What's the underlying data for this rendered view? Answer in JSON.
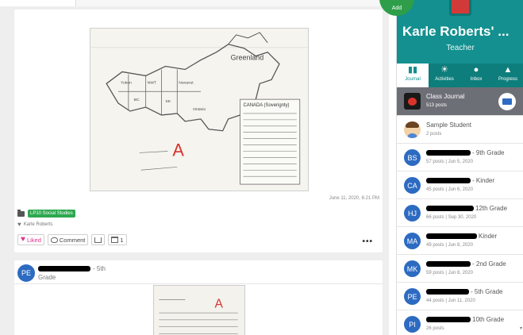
{
  "header": {
    "tab_text": "",
    "add_label": "Add"
  },
  "post1": {
    "date": "June 11, 2020, 6:21 PM",
    "tag": "LP10 Social Studies",
    "liker": "Karle Roberts",
    "like_label": "Liked",
    "comment_label": "Comment",
    "folder_count": "1",
    "more": "•••",
    "photo_note_title": "CANADA (Soverignty)",
    "photo_grade": "A"
  },
  "post2": {
    "initials": "PE",
    "name_suffix": "- 5th",
    "grade_word": "Grade",
    "photo_grade": "A"
  },
  "panel": {
    "name": "Karle Roberts' ...",
    "role": "Teacher",
    "tabs": [
      {
        "label": "Journal",
        "icon": "book-icon"
      },
      {
        "label": "Activities",
        "icon": "lightbulb-icon"
      },
      {
        "label": "Inbox",
        "icon": "chat-icon"
      },
      {
        "label": "Progress",
        "icon": "graduation-cap-icon"
      }
    ],
    "class_journal": {
      "title": "Class Journal",
      "sub": "513 posts"
    },
    "sample": {
      "title": "Sample Student",
      "sub": "2 posts"
    },
    "students": [
      {
        "initials": "BS",
        "suffix": "- 9th Grade",
        "sub": "57 posts | Jun 5, 2020",
        "color": "#2d6bc2"
      },
      {
        "initials": "CA",
        "suffix": "- Kinder",
        "sub": "45 posts | Jun 6, 2020",
        "color": "#2d6bc2"
      },
      {
        "initials": "HJ",
        "suffix": "12th Grade",
        "sub": "66 posts | Sep 30, 2020",
        "color": "#2d6bc2"
      },
      {
        "initials": "MA",
        "suffix": "Kinder",
        "sub": "49 posts | Jun 8, 2020",
        "color": "#2d6bc2"
      },
      {
        "initials": "MK",
        "suffix": "- 2nd Grade",
        "sub": "59 posts | Jun 8, 2020",
        "color": "#2d6bc2"
      },
      {
        "initials": "PE",
        "suffix": "- 5th Grade",
        "sub": "44 posts | Jun 11, 2020",
        "color": "#2d6bc2"
      },
      {
        "initials": "PI",
        "suffix": "10th Grade",
        "sub": "26 posts",
        "color": "#2d6bc2"
      }
    ]
  }
}
